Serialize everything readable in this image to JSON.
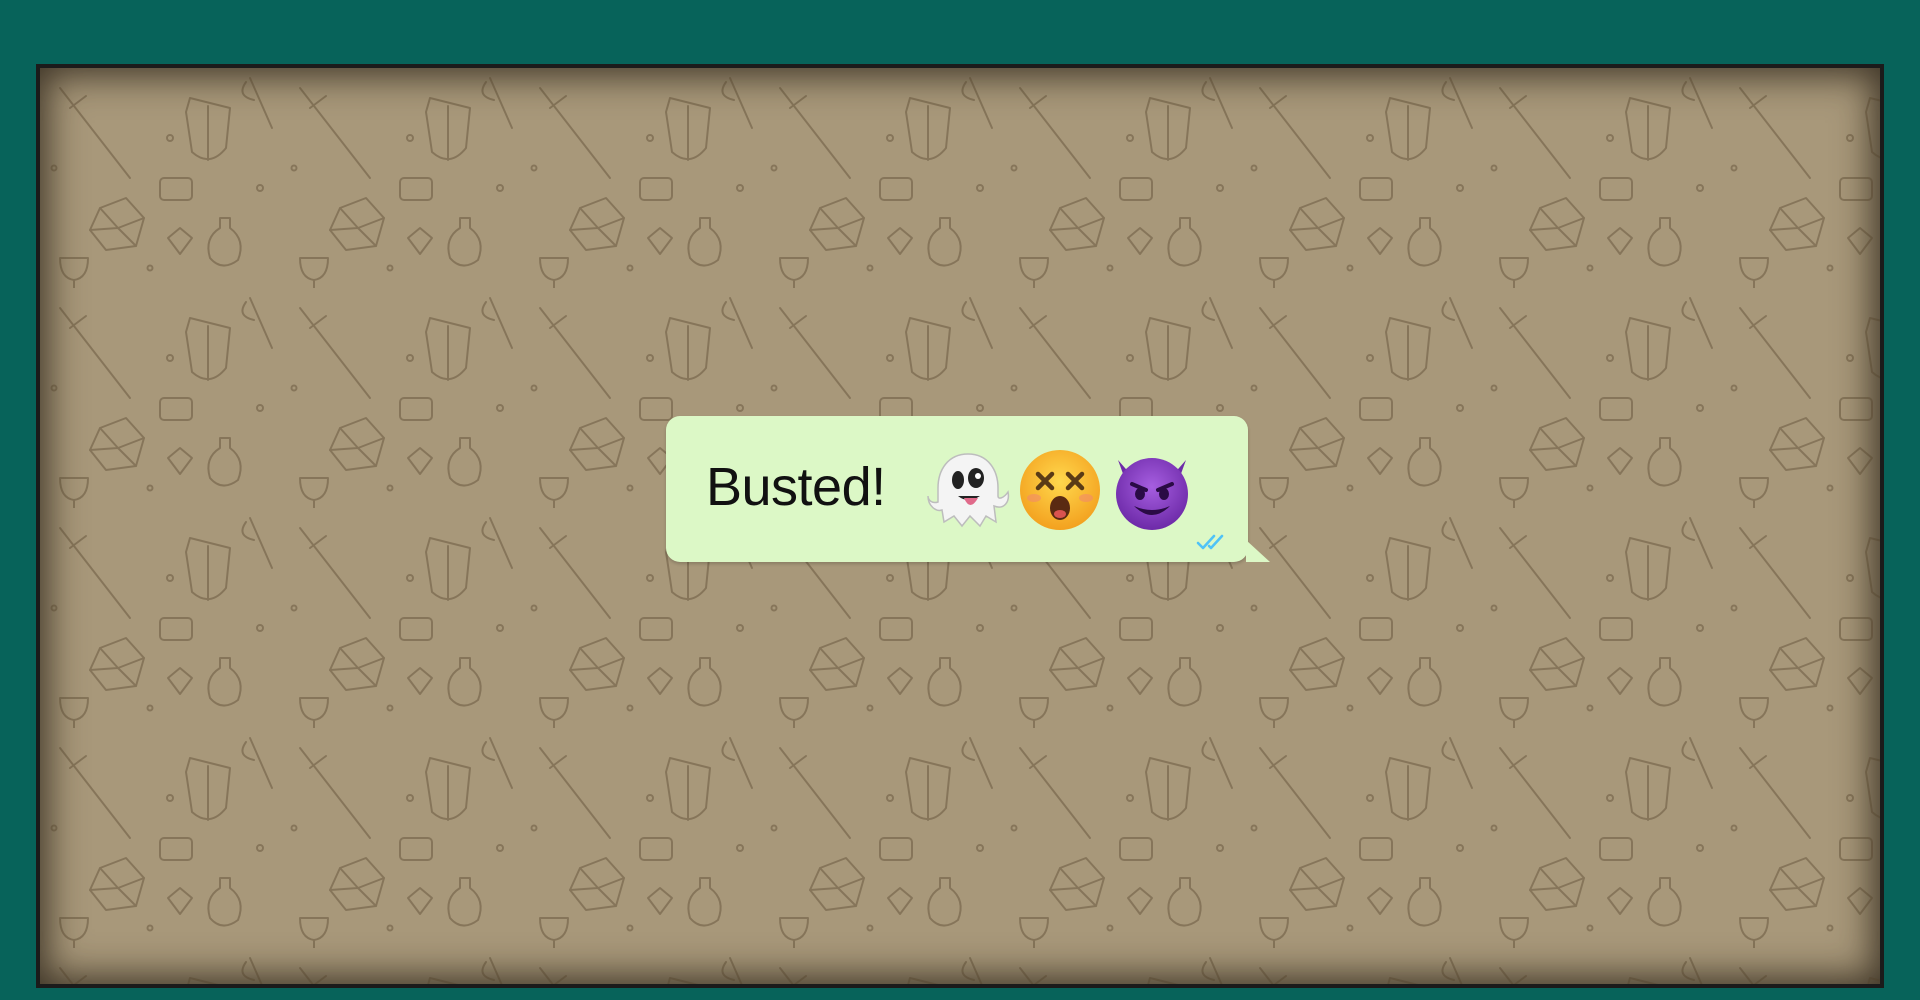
{
  "chat": {
    "message": {
      "text": "Busted!",
      "emojis": [
        "ghost-icon",
        "dizzy-face-icon",
        "smiling-devil-icon"
      ],
      "status": "read",
      "tick_color": "#4fc3f7"
    },
    "bubble_color": "#dcf8c6",
    "wallpaper_color": "#a8987a",
    "frame_color": "#07635a"
  }
}
